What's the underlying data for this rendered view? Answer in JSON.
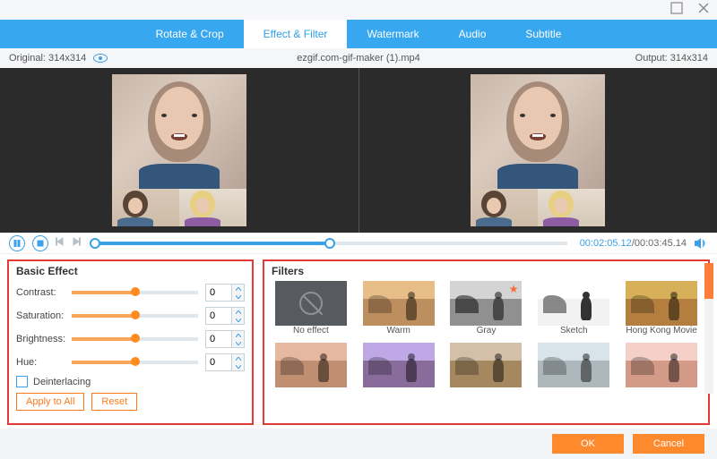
{
  "tabs": [
    "Rotate & Crop",
    "Effect & Filter",
    "Watermark",
    "Audio",
    "Subtitle"
  ],
  "active_tab": 1,
  "info": {
    "original_label": "Original:",
    "original_dim": "314x314",
    "filename": "ezgif.com-gif-maker (1).mp4",
    "output_label": "Output:",
    "output_dim": "314x314"
  },
  "playback": {
    "current": "00:02:05.12",
    "total": "00:03:45.14"
  },
  "basic": {
    "title": "Basic Effect",
    "rows": [
      {
        "label": "Contrast:",
        "value": "0"
      },
      {
        "label": "Saturation:",
        "value": "0"
      },
      {
        "label": "Brightness:",
        "value": "0"
      },
      {
        "label": "Hue:",
        "value": "0"
      }
    ],
    "deinterlacing": "Deinterlacing",
    "apply_all": "Apply to All",
    "reset": "Reset"
  },
  "filters": {
    "title": "Filters",
    "items": [
      "No effect",
      "Warm",
      "Gray",
      "Sketch",
      "Hong Kong Movie",
      "",
      "",
      "",
      "",
      ""
    ]
  },
  "footer": {
    "ok": "OK",
    "cancel": "Cancel"
  }
}
